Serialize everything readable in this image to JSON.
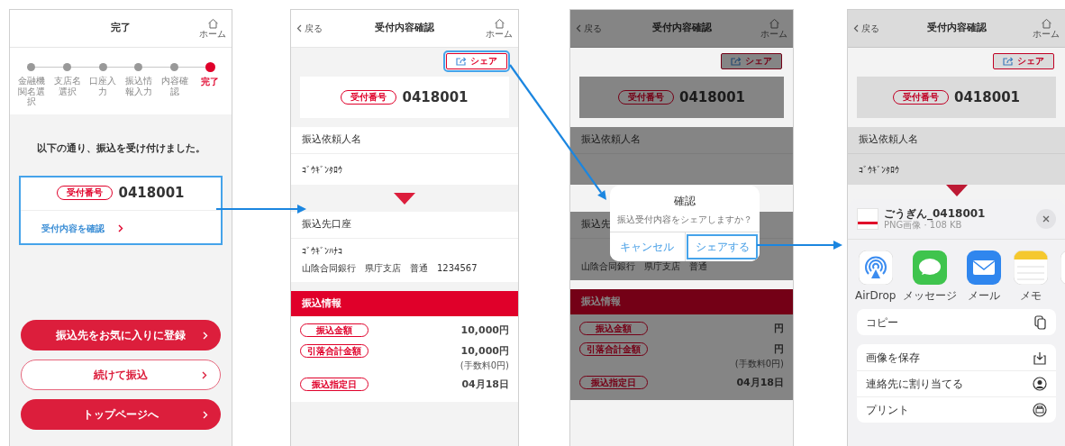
{
  "screens": [
    {
      "kind": "complete",
      "header": {
        "title": "完了",
        "home_label": "ホーム"
      },
      "steps": [
        {
          "label": "金融機関名選択",
          "selected": false
        },
        {
          "label": "支店名選択",
          "selected": false
        },
        {
          "label": "口座入力",
          "selected": false
        },
        {
          "label": "振込情報入力",
          "selected": false
        },
        {
          "label": "内容確認",
          "selected": false
        },
        {
          "label": "完了",
          "selected": true
        }
      ],
      "message": "以下の通り、振込を受け付けました。",
      "receipt": {
        "badge": "受付番号",
        "number": "0418001",
        "link": "受付内容を確認",
        "highlighted": true
      },
      "buttons": [
        {
          "label": "振込先をお気に入りに登録",
          "kind": "filled"
        },
        {
          "label": "続けて振込",
          "kind": "outline"
        },
        {
          "label": "トップページへ",
          "kind": "filled"
        }
      ]
    },
    {
      "kind": "detail",
      "header": {
        "back_label": "戻る",
        "title": "受付内容確認",
        "home_label": "ホーム"
      },
      "share_button": {
        "label": "シェア",
        "highlighted": true
      },
      "receipt": {
        "badge": "受付番号",
        "number": "0418001"
      },
      "sender": {
        "label": "振込依頼人名",
        "value": "ｺﾞｳｷﾞﾝﾀﾛｳ"
      },
      "payee": {
        "label": "振込先口座",
        "name": "ｺﾞｳｷﾞﾝﾊﾅｺ",
        "account": "山陰合同銀行　県庁支店　普通　1234567"
      },
      "info": {
        "title": "振込情報",
        "rows": [
          {
            "label": "振込金額",
            "value": "10,000円"
          },
          {
            "label": "引落合計金額",
            "value": "10,000円",
            "note": "(手数料0円)"
          },
          {
            "label": "振込指定日",
            "value": "04月18日"
          }
        ]
      }
    },
    {
      "kind": "detail",
      "header": {
        "back_label": "戻る",
        "title": "受付内容確認",
        "home_label": "ホーム"
      },
      "share_button": {
        "label": "シェア",
        "highlighted": false
      },
      "receipt": {
        "badge": "受付番号",
        "number": "0418001"
      },
      "sender": {
        "label": "振込依頼人名"
      },
      "payee": {
        "label": "振込先",
        "account": "山陰合同銀行　県庁支店　普通"
      },
      "info": {
        "title": "振込情報",
        "rows": [
          {
            "label": "振込金額",
            "value": "円"
          },
          {
            "label": "引落合計金額",
            "value": "円",
            "note": "(手数料0円)"
          },
          {
            "label": "振込指定日",
            "value": "04月18日"
          }
        ]
      },
      "overlay": {
        "kind": "dialog",
        "title": "確認",
        "message": "振込受付内容をシェアしますか？",
        "buttons": [
          {
            "label": "キャンセル",
            "highlighted": false
          },
          {
            "label": "シェアする",
            "highlighted": true
          }
        ]
      }
    },
    {
      "kind": "detail",
      "header": {
        "back_label": "戻る",
        "title": "受付内容確認",
        "home_label": "ホーム"
      },
      "share_button": {
        "label": "シェア",
        "highlighted": false
      },
      "receipt": {
        "badge": "受付番号",
        "number": "0418001"
      },
      "sender": {
        "label": "振込依頼人名",
        "value": "ｺﾞｳｷﾞﾝﾀﾛｳ"
      },
      "overlay": {
        "kind": "share_sheet",
        "file_name": "ごうぎん_0418001",
        "file_info": "PNG画像 · 108 KB",
        "apps": [
          {
            "kind": "airdrop",
            "label": "AirDrop"
          },
          {
            "kind": "messages",
            "label": "メッセージ"
          },
          {
            "kind": "mail",
            "label": "メール"
          },
          {
            "kind": "notes",
            "label": "メモ"
          },
          {
            "kind": "reminders"
          }
        ],
        "action_groups": [
          {
            "actions": [
              {
                "kind": "copy",
                "label": "コピー"
              }
            ]
          },
          {
            "actions": [
              {
                "kind": "save",
                "label": "画像を保存"
              },
              {
                "kind": "contact",
                "label": "連絡先に割り当てる"
              },
              {
                "kind": "print",
                "label": "プリント"
              }
            ]
          }
        ]
      }
    }
  ]
}
